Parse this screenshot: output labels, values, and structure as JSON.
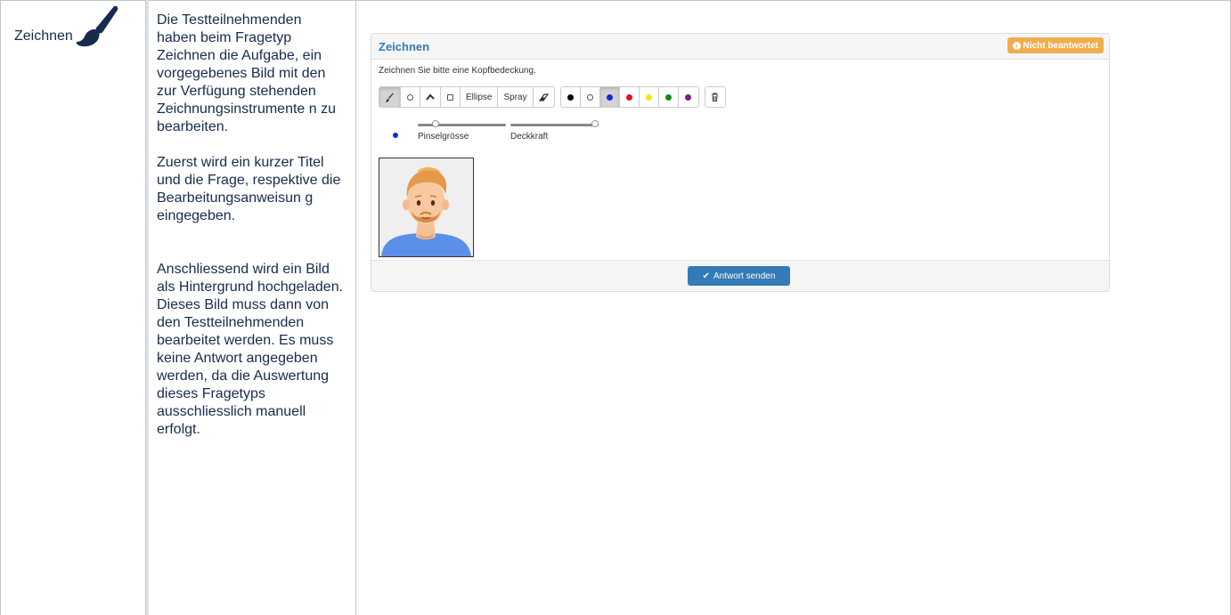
{
  "row_label": "Zeichnen",
  "description": {
    "p1": "Die Testteilnehmenden haben beim Fragetyp Zeichnen die Aufgabe, ein vorgegebenes Bild mit den zur Verfügung stehenden Zeichnungsinstrumente n zu bearbeiten.",
    "p2": "Zuerst wird ein kurzer Titel und die Frage, respektive die Bearbeitungsanweisun g eingegeben.",
    "p3": "Anschliessend wird ein Bild als Hintergrund hochgeladen. Dieses Bild muss dann von den Testteilnehmenden bearbeitet werden. Es muss keine Antwort angegeben werden, da die Auswertung dieses Fragetyps ausschliesslich manuell erfolgt."
  },
  "panel": {
    "title": "Zeichnen",
    "status_badge": "Nicht beantwortet",
    "question": "Zeichnen Sie bitte eine Kopfbedeckung.",
    "tools": {
      "ellipse": "Ellipse",
      "spray": "Spray"
    },
    "colors": {
      "black": "#000000",
      "white": "#ffffff",
      "blue": "#0a2be0",
      "red": "#e8111c",
      "yellow": "#f4e416",
      "green": "#128a1b",
      "purple": "#7b1a8c",
      "accent": "#337ab7",
      "badge": "#f0ad4e"
    },
    "brush_size_label": "Pinselgrösse",
    "opacity_label": "Deckkraft",
    "brush_size_level": 0.18,
    "opacity_level": 1.0,
    "submit_label": "Antwort senden"
  }
}
